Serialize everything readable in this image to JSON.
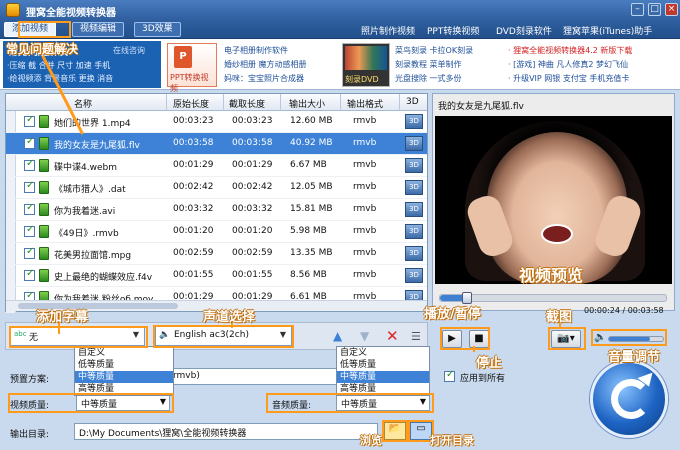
{
  "window": {
    "title": "狸窝全能视频转换器"
  },
  "menu_tabs": [
    {
      "label": "添加视频"
    },
    {
      "label": "视频编辑"
    },
    {
      "label": "3D效果"
    }
  ],
  "top_links": [
    "照片制作视频",
    "PPT转换视频",
    "DVD刻录软件",
    "狸窝苹果(iTunes)助手"
  ],
  "faq": {
    "title": "常见问题解决",
    "online": "在线咨询",
    "line1": "·压缩  截  合并  尺寸  加速  手机",
    "line2": "·给视频添  背景音乐  更换  消音"
  },
  "ads": {
    "ppt_caption": "PPT转换视频",
    "ppt_logo": "P",
    "col1": [
      "电子相册制作软件",
      "婚纱相册  魔方动感相册",
      "妈咪：宝宝照片合成器"
    ],
    "dvd_caption": "刻录DVD",
    "col2": [
      "菜鸟刻录  卡拉OK刻录",
      "刻录教程  菜单制作",
      "光盘搜除  一式多份"
    ],
    "col3_line1_red": "· 狸窝全能视频转换器4.2  新版下载",
    "col3_line2": "· [游戏] 神曲  凡人修真2  梦幻飞仙",
    "col3_line3": "· 升级VIP  网银  支付宝  手机充值卡"
  },
  "file_list": {
    "headers": [
      "名称",
      "原始长度",
      "截取长度",
      "输出大小",
      "输出格式",
      "3D"
    ],
    "rows": [
      {
        "name": "她们的世界 1.mp4",
        "orig": "00:03:23",
        "cut": "00:03:23",
        "size": "12.60 MB",
        "fmt": "rmvb",
        "selected": false
      },
      {
        "name": "我的女友是九尾狐.flv",
        "orig": "00:03:58",
        "cut": "00:03:58",
        "size": "40.92 MB",
        "fmt": "rmvb",
        "selected": true
      },
      {
        "name": "碟中谍4.webm",
        "orig": "00:01:29",
        "cut": "00:01:29",
        "size": "6.67 MB",
        "fmt": "rmvb",
        "selected": false
      },
      {
        "name": "《城市猎人》.dat",
        "orig": "00:02:42",
        "cut": "00:02:42",
        "size": "12.05 MB",
        "fmt": "rmvb",
        "selected": false
      },
      {
        "name": "你为我着迷.avi",
        "orig": "00:03:32",
        "cut": "00:03:32",
        "size": "15.81 MB",
        "fmt": "rmvb",
        "selected": false
      },
      {
        "name": "《49日》.rmvb",
        "orig": "00:01:20",
        "cut": "00:01:20",
        "size": "5.98 MB",
        "fmt": "rmvb",
        "selected": false
      },
      {
        "name": "花美男拉面馆.mpg",
        "orig": "00:02:59",
        "cut": "00:02:59",
        "size": "13.35 MB",
        "fmt": "rmvb",
        "selected": false
      },
      {
        "name": "史上最绝的蝴蝶效应.f4v",
        "orig": "00:01:55",
        "cut": "00:01:55",
        "size": "8.56 MB",
        "fmt": "rmvb",
        "selected": false
      },
      {
        "name": "你为我着迷 粉丝об.mov",
        "orig": "00:01:29",
        "cut": "00:01:29",
        "size": "6.61 MB",
        "fmt": "rmvb",
        "selected": false
      }
    ],
    "td_label": "3D"
  },
  "preview": {
    "title": "我的女友是九尾狐.flv",
    "overlay": "视频预览",
    "time": "00:00:24 / 00:03:58",
    "progress": 0.12,
    "volume": 0.75
  },
  "controls": {
    "subtitle_value": "无",
    "subtitle_icon": "abc",
    "audio_value": "English ac3(2ch)"
  },
  "quality_options": [
    "自定义",
    "低等质量",
    "中等质量",
    "高等质量"
  ],
  "quality_highlight": "中等质量",
  "lower": {
    "preset_label": "预置方案:",
    "preset_value": "rmvb)",
    "apply_all": "应用到所有",
    "video_quality_label": "视频质量:",
    "video_quality_value": "中等质量",
    "audio_quality_label": "音频质量:",
    "audio_quality_value": "中等质量",
    "output_label": "输出目录:",
    "output_value": "D:\\My Documents\\狸窝\\全能视频转换器"
  },
  "annotations": {
    "common_faq": "常见问题解决",
    "add_subtitle": "添加字幕",
    "audio_select": "声道选择",
    "play_pause": "播放/暂停",
    "stop": "停止",
    "screenshot": "截图",
    "volume": "音量调节",
    "browse": "浏览",
    "open_dir": "打开目录"
  },
  "colors": {
    "accent": "#3d82d6",
    "annotation": "#ff9a1a",
    "titlebar": "#2f5f9f"
  }
}
